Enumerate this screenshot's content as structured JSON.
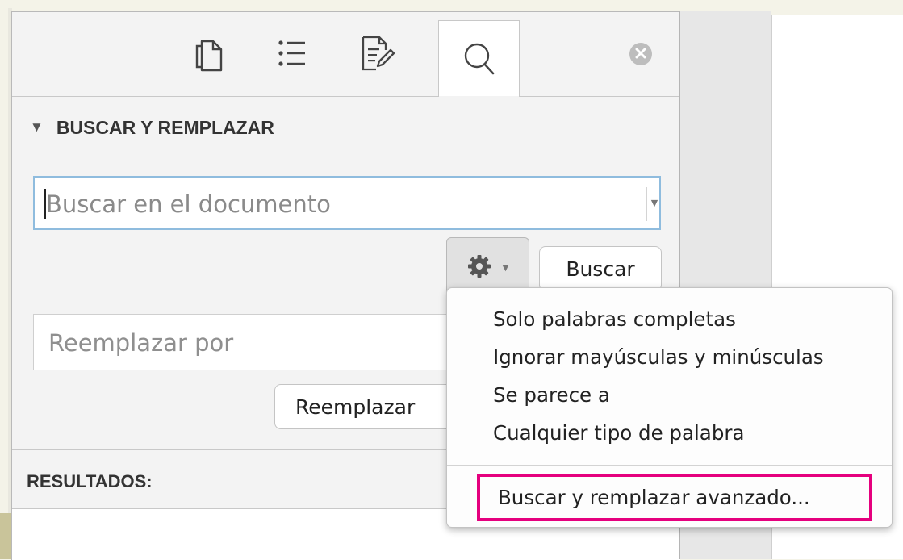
{
  "panel": {
    "tabs": [
      {
        "icon": "pages-icon",
        "active": false
      },
      {
        "icon": "list-icon",
        "active": false
      },
      {
        "icon": "edit-document-icon",
        "active": false
      },
      {
        "icon": "search-icon",
        "active": true
      }
    ],
    "close_icon": "close-icon",
    "section_title": "BUSCAR Y REMPLAZAR",
    "search_placeholder": "Buscar en el documento",
    "search_value": "",
    "search_button": "Buscar",
    "options_icon": "gear-icon",
    "replace_placeholder": "Reemplazar por",
    "replace_value": "",
    "replace_button": "Reemplazar",
    "results_label": "RESULTADOS:"
  },
  "options_menu": {
    "items": [
      "Solo palabras completas",
      "Ignorar mayúsculas y minúsculas",
      "Se parece a",
      "Cualquier tipo de palabra"
    ],
    "advanced": "Buscar y remplazar avanzado...",
    "highlight_color": "#e5007e"
  },
  "colors": {
    "panel_bg": "#f3f3f3",
    "focus_border": "#8fbcde",
    "page_bg": "#f4f3e8"
  }
}
